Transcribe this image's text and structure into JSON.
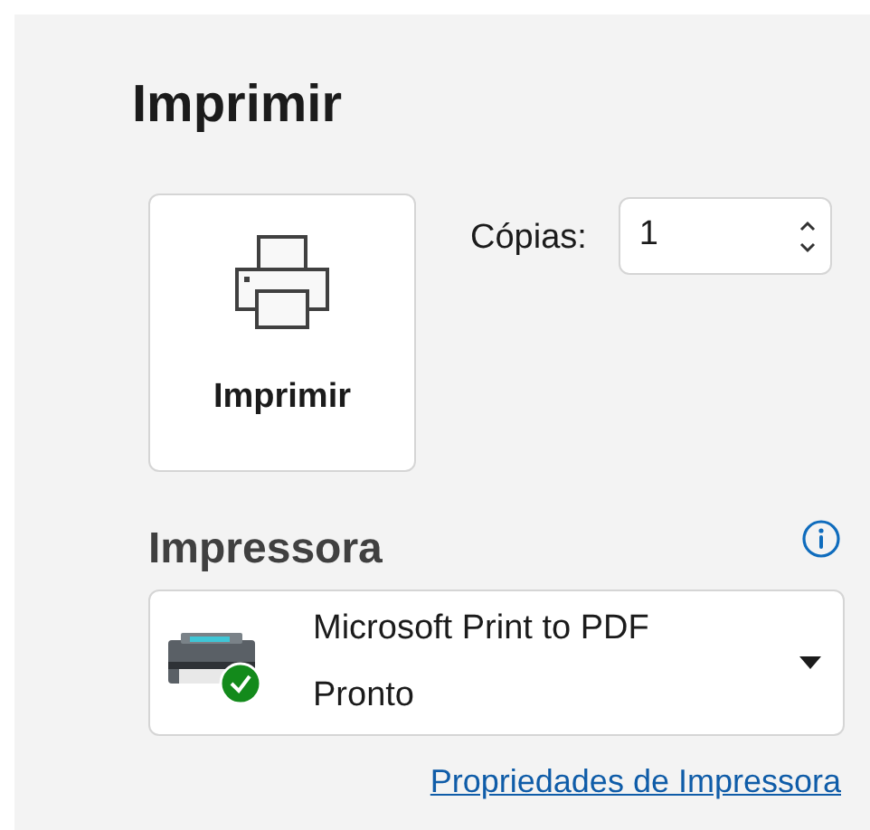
{
  "title": "Imprimir",
  "print_button": {
    "label": "Imprimir"
  },
  "copies": {
    "label": "Cópias:",
    "value": "1"
  },
  "printer": {
    "heading": "Impressora",
    "name": "Microsoft Print to PDF",
    "status": "Pronto",
    "properties_link": "Propriedades de Impressora"
  }
}
